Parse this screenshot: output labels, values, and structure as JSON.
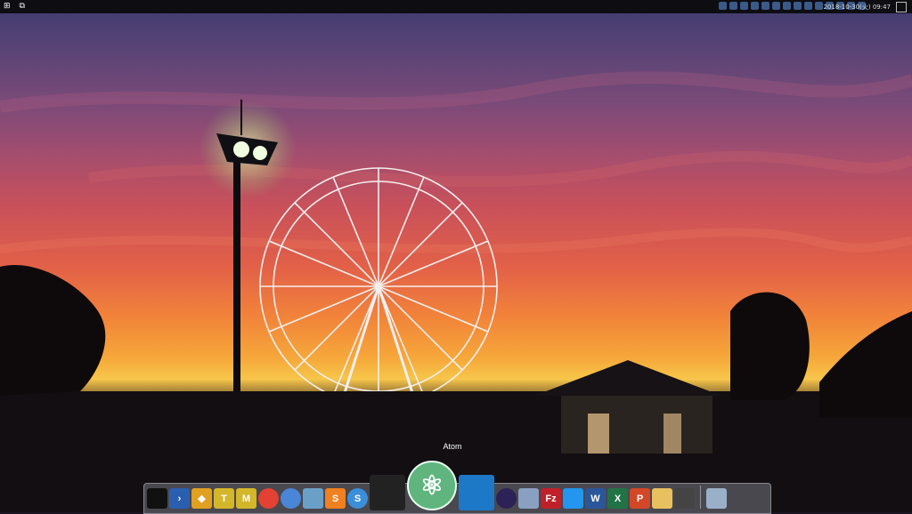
{
  "taskbar": {
    "clock": "2018-10-30(火) 09:47",
    "tray_icons": [
      "tray-app-1",
      "tray-app-2",
      "tray-app-3",
      "tray-app-4",
      "tray-app-5",
      "tray-app-6",
      "tray-app-7",
      "tray-app-8",
      "bluetooth-icon",
      "volume-muted-icon",
      "wifi-icon",
      "battery-icon",
      "ime-icon",
      "notification-icon"
    ]
  },
  "dock": {
    "hover_label": "Atom",
    "items": [
      {
        "name": "terminal",
        "label": "",
        "color": "#111111"
      },
      {
        "name": "powershell",
        "label": "›",
        "color": "#2a5fb0"
      },
      {
        "name": "git-app",
        "label": "◆",
        "color": "#e0a020"
      },
      {
        "name": "text-editor-t",
        "label": "T",
        "color": "#d4b62a"
      },
      {
        "name": "text-editor-m",
        "label": "M",
        "color": "#d4b62a"
      },
      {
        "name": "chrome",
        "label": "",
        "color": "#e34133"
      },
      {
        "name": "chromium",
        "label": "",
        "color": "#4a86d8"
      },
      {
        "name": "notes-app",
        "label": "",
        "color": "#6aa0c8"
      },
      {
        "name": "sublime-text",
        "label": "S",
        "color": "#f08020"
      },
      {
        "name": "simplenote",
        "label": "S",
        "color": "#3b8fd8"
      },
      {
        "name": "wizard-app",
        "label": "",
        "color": "#222222"
      },
      {
        "name": "atom",
        "label": "⚛",
        "color": "#5fb57d"
      },
      {
        "name": "vscode",
        "label": "",
        "color": "#1d78c8"
      },
      {
        "name": "eclipse",
        "label": "",
        "color": "#2c2255"
      },
      {
        "name": "database-app",
        "label": "",
        "color": "#8aa0c0"
      },
      {
        "name": "filezilla",
        "label": "Fz",
        "color": "#c0202a"
      },
      {
        "name": "docker",
        "label": "",
        "color": "#2496ed"
      },
      {
        "name": "word",
        "label": "W",
        "color": "#2b579a"
      },
      {
        "name": "excel",
        "label": "X",
        "color": "#217346"
      },
      {
        "name": "powerpoint",
        "label": "P",
        "color": "#d24726"
      },
      {
        "name": "paint",
        "label": "",
        "color": "#e8c060"
      },
      {
        "name": "inkscape",
        "label": "",
        "color": "#444444"
      },
      {
        "name": "recycle-bin",
        "label": "",
        "color": "#9ab0c8"
      }
    ]
  }
}
